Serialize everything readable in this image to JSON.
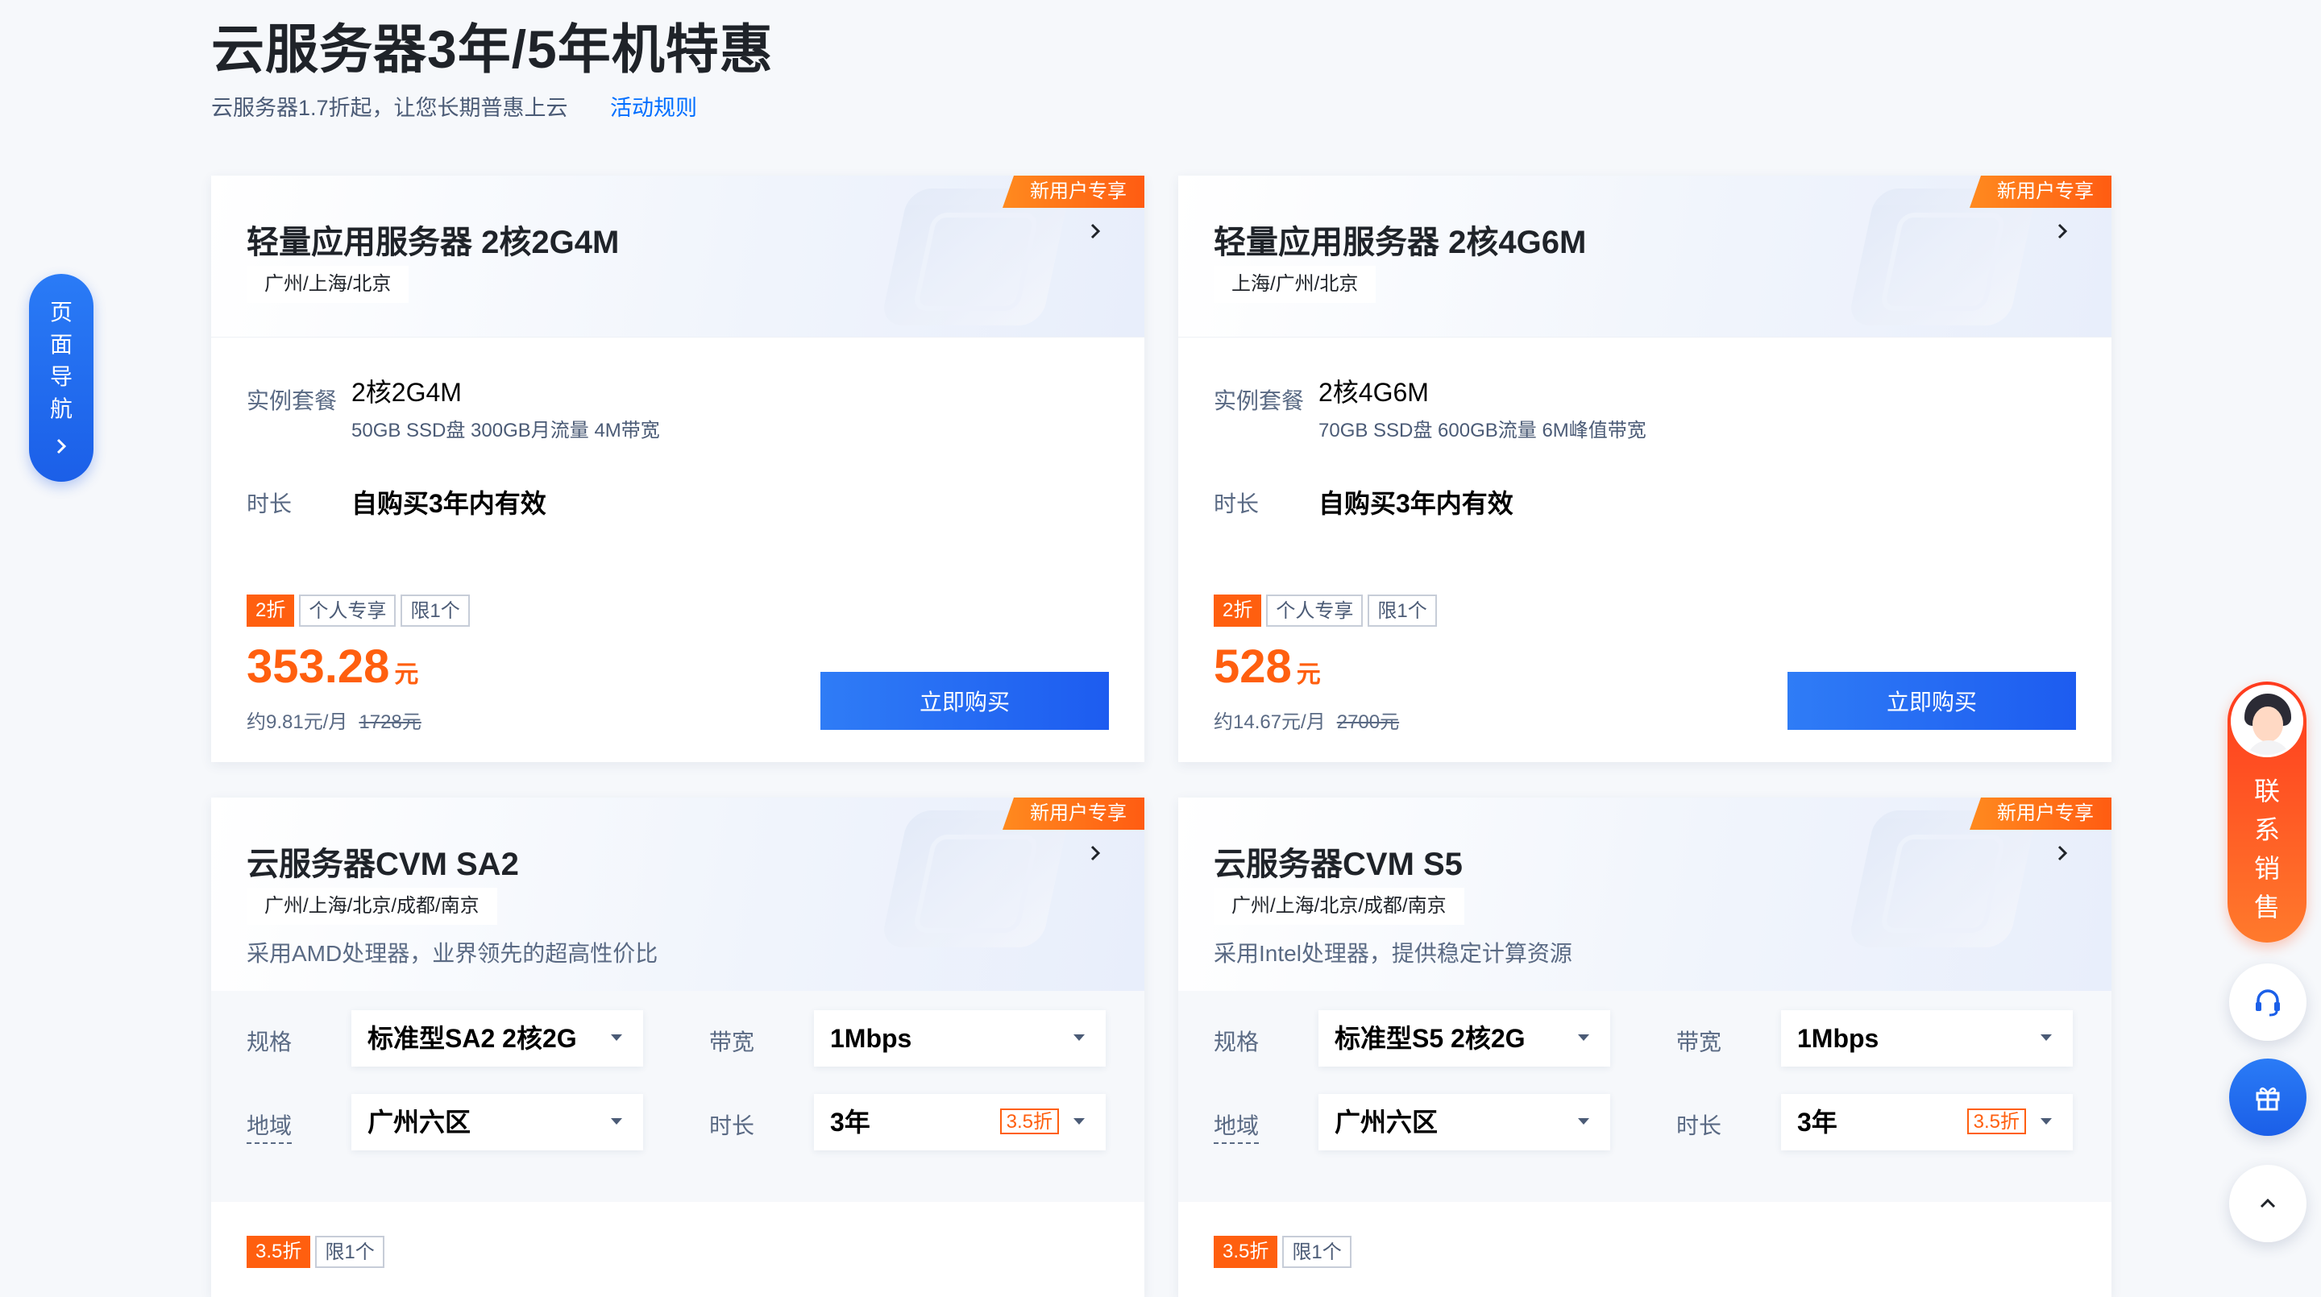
{
  "header": {
    "title": "云服务器3年/5年机特惠",
    "subtitle": "云服务器1.7折起，让您长期普惠上云",
    "rules_link": "活动规则"
  },
  "side_nav": {
    "label": "页面导航"
  },
  "contact": {
    "label": "联系销售"
  },
  "cards": [
    {
      "ribbon": "新用户专享",
      "title": "轻量应用服务器 2核2G4M",
      "regions": "广州/上海/北京",
      "plan_label": "实例套餐",
      "plan_value": "2核2G4M",
      "plan_detail": "50GB SSD盘 300GB月流量 4M带宽",
      "duration_label": "时长",
      "duration_value": "自购买3年内有效",
      "tags": [
        "2折",
        "个人专享",
        "限1个"
      ],
      "price": "353.28",
      "price_unit": "元",
      "monthly": "约9.81元/月",
      "original": "1728元",
      "buy": "立即购买"
    },
    {
      "ribbon": "新用户专享",
      "title": "轻量应用服务器 2核4G6M",
      "regions": "上海/广州/北京",
      "plan_label": "实例套餐",
      "plan_value": "2核4G6M",
      "plan_detail": "70GB SSD盘 600GB流量 6M峰值带宽",
      "duration_label": "时长",
      "duration_value": "自购买3年内有效",
      "tags": [
        "2折",
        "个人专享",
        "限1个"
      ],
      "price": "528",
      "price_unit": "元",
      "monthly": "约14.67元/月",
      "original": "2700元",
      "buy": "立即购买"
    },
    {
      "ribbon": "新用户专享",
      "title": "云服务器CVM SA2",
      "regions": "广州/上海/北京/成都/南京",
      "desc": "采用AMD处理器，业界领先的超高性价比",
      "spec_label": "规格",
      "spec_value": "标准型SA2 2核2G",
      "bandwidth_label": "带宽",
      "bandwidth_value": "1Mbps",
      "region_label": "地域",
      "region_value": "广州六区",
      "duration_label": "时长",
      "duration_value": "3年",
      "duration_discount": "3.5折",
      "tags": [
        "3.5折",
        "限1个"
      ]
    },
    {
      "ribbon": "新用户专享",
      "title": "云服务器CVM S5",
      "regions": "广州/上海/北京/成都/南京",
      "desc": "采用Intel处理器，提供稳定计算资源",
      "spec_label": "规格",
      "spec_value": "标准型S5 2核2G",
      "bandwidth_label": "带宽",
      "bandwidth_value": "1Mbps",
      "region_label": "地域",
      "region_value": "广州六区",
      "duration_label": "时长",
      "duration_value": "3年",
      "duration_discount": "3.5折",
      "tags": [
        "3.5折",
        "限1个"
      ]
    }
  ],
  "colors": {
    "accent_blue": "#006eff",
    "button_blue": "#1d5cf0",
    "price_orange": "#ff5f0f",
    "ribbon_orange": "#ff6a16"
  },
  "icons": [
    "chevron-right-icon",
    "dropdown-arrow-icon",
    "headset-icon",
    "gift-icon",
    "chevron-up-icon",
    "avatar-icon"
  ]
}
